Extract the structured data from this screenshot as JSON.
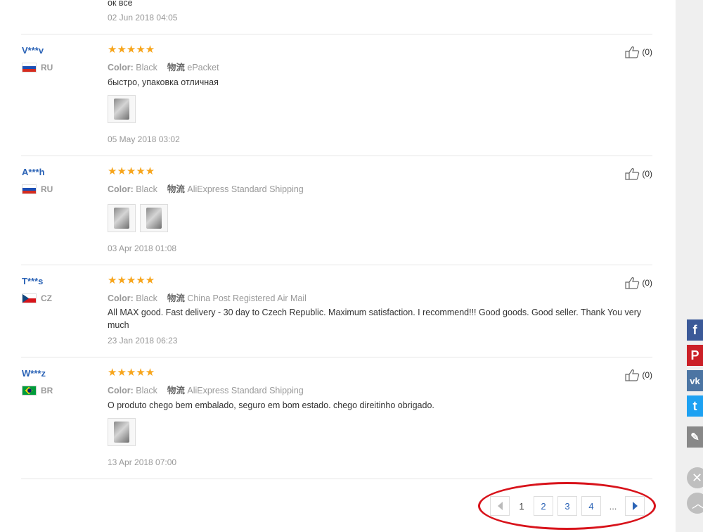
{
  "top_partial": {
    "text": "ок все",
    "date": "02 Jun 2018 04:05"
  },
  "reviews": [
    {
      "user": "V***v",
      "country": "RU",
      "stars": "★★★★★",
      "color_label": "Color:",
      "color_value": "Black",
      "ship_label": "物流",
      "ship_value": "ePacket",
      "text": "быстро, упаковка отличная",
      "date": "05 May 2018 03:02",
      "helpful": "(0)"
    },
    {
      "user": "A***h",
      "country": "RU",
      "stars": "★★★★★",
      "color_label": "Color:",
      "color_value": "Black",
      "ship_label": "物流",
      "ship_value": "AliExpress Standard Shipping",
      "text": "",
      "date": "03 Apr 2018 01:08",
      "helpful": "(0)"
    },
    {
      "user": "T***s",
      "country": "CZ",
      "stars": "★★★★★",
      "color_label": "Color:",
      "color_value": "Black",
      "ship_label": "物流",
      "ship_value": "China Post Registered Air Mail",
      "text": "All MAX good. Fast delivery - 30 day to Czech Republic. Maximum satisfaction. I recommend!!! Good goods. Good seller. Thank You very much",
      "date": "23 Jan 2018 06:23",
      "helpful": "(0)"
    },
    {
      "user": "W***z",
      "country": "BR",
      "stars": "★★★★★",
      "color_label": "Color:",
      "color_value": "Black",
      "ship_label": "物流",
      "ship_value": "AliExpress Standard Shipping",
      "text": "O produto chego bem embalado, seguro em bom estado. chego direitinho obrigado.",
      "date": "13 Apr 2018 07:00",
      "helpful": "(0)"
    }
  ],
  "pagination": {
    "current": "1",
    "pages": [
      "2",
      "3",
      "4"
    ],
    "ellipsis": "..."
  },
  "share": {
    "facebook": "f",
    "pinterest": "P",
    "vk": "vk",
    "twitter": "t"
  },
  "colors": {
    "link": "#2b63b6",
    "stars": "#f7a51c",
    "highlight_oval": "#d8131b"
  }
}
